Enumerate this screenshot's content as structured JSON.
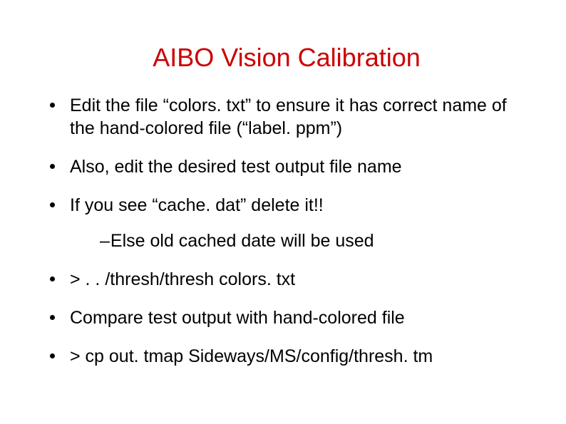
{
  "title": "AIBO Vision Calibration",
  "bullets": {
    "b1": "Edit the file “colors. txt” to ensure it has correct name of the hand-colored file (“label. ppm”)",
    "b2": "Also, edit the desired test output file name",
    "b3": "If you see “cache. dat” delete it!!",
    "sub1_dash": "–",
    "sub1_text": "Else old cached date will be used",
    "b4": "> . . /thresh/thresh colors. txt",
    "b5": "Compare test output with hand-colored file",
    "b6": "> cp out. tmap Sideways/MS/config/thresh. tm"
  }
}
